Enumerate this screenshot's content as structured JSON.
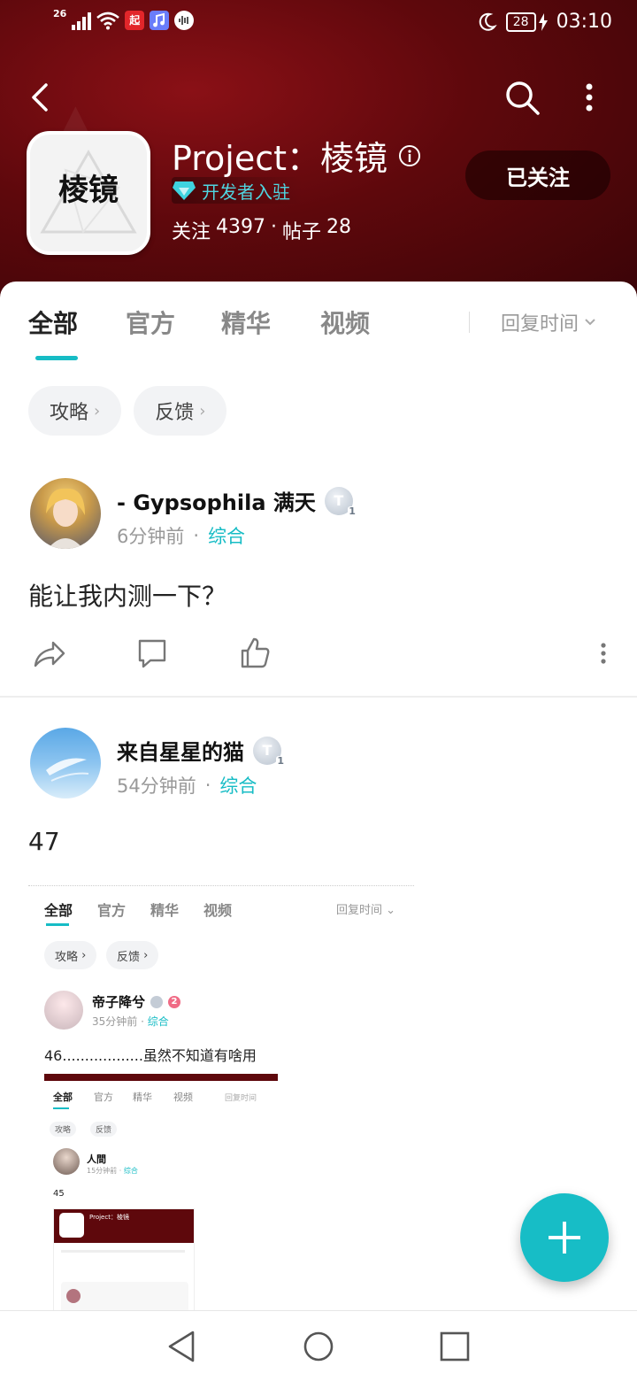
{
  "status_bar": {
    "network": "26",
    "app_icon_1": "起",
    "time": "03:10",
    "battery": "28"
  },
  "header": {
    "title": "Project：棱镜",
    "developer_badge": "开发者入驻",
    "follow_label": "关注",
    "follow_count": "4397",
    "separator": "·",
    "posts_label": "帖子",
    "posts_count": "28",
    "follow_button": "已关注",
    "logo_text": "棱镜"
  },
  "tabs": {
    "items": [
      "全部",
      "官方",
      "精华",
      "视频"
    ],
    "active": "全部",
    "sort": "回复时间"
  },
  "chips": [
    "攻略",
    "反馈"
  ],
  "posts": [
    {
      "author": "- Gypsophila 满天",
      "level_badge": "T",
      "level_num": "1",
      "time": "6分钟前",
      "dot": "·",
      "category": "综合",
      "body": "能让我内测一下？"
    },
    {
      "author": "来自星星的猫",
      "level_badge": "T",
      "level_num": "1",
      "time": "54分钟前",
      "dot": "·",
      "category": "综合",
      "body": "47"
    }
  ],
  "embedded_screenshot": {
    "tabs": [
      "全部",
      "官方",
      "精华",
      "视频"
    ],
    "sort": "回复时间",
    "chips": [
      "攻略",
      "反馈"
    ],
    "author": "帝子降兮",
    "badge_num": "2",
    "time": "35分钟前",
    "category": "综合",
    "body": "46..................虽然不知道有啥用",
    "nested": {
      "tabs": [
        "全部",
        "官方",
        "精华",
        "视频"
      ],
      "sort": "回复时间",
      "chips": [
        "攻略",
        "反馈"
      ],
      "author": "人間",
      "time": "15分钟前",
      "category": "综合",
      "body": "45",
      "inner_title": "Project：棱镜"
    }
  },
  "colors": {
    "accent": "#16bcc5",
    "header_bg": "#5e080c"
  }
}
